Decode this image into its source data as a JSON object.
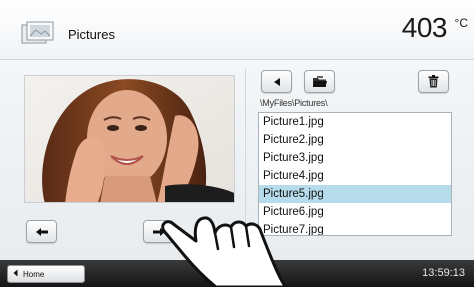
{
  "header": {
    "title": "Pictures",
    "temperature": "403",
    "unit": "°C",
    "icon": "pictures-folder-icon"
  },
  "toolbar": {
    "back_icon": "arrow-left-icon",
    "open_folder_icon": "folder-open-icon",
    "delete_icon": "trash-icon"
  },
  "path": "\\MyFiles\\Pictures\\",
  "files": [
    {
      "name": "Picture1.jpg",
      "selected": false
    },
    {
      "name": "Picture2.jpg",
      "selected": false
    },
    {
      "name": "Picture3.jpg",
      "selected": false
    },
    {
      "name": "Picture4.jpg",
      "selected": false
    },
    {
      "name": "Picture5.jpg",
      "selected": true
    },
    {
      "name": "Picture6.jpg",
      "selected": false
    },
    {
      "name": "Picture7.jpg",
      "selected": false
    }
  ],
  "preview": {
    "prev_icon": "arrow-left-icon",
    "next_icon": "arrow-right-icon"
  },
  "footer": {
    "home_label": "Home",
    "home_icon": "chevron-left-icon",
    "time": "13:59:13"
  },
  "colors": {
    "selection": "#b6dcec",
    "footer": "#1f1f1f"
  }
}
